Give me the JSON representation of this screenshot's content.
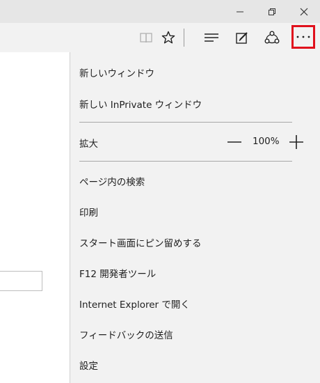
{
  "window_controls": {
    "minimize_icon": "minimize-icon",
    "restore_icon": "restore-icon",
    "close_icon": "close-icon"
  },
  "toolbar": {
    "icons": [
      "reading-view-icon",
      "favorite-star-icon",
      "hub-icon",
      "web-note-icon",
      "share-icon",
      "more-actions-icon"
    ],
    "highlight_color": "#e0101c"
  },
  "menu": {
    "new_window": "新しいウィンドウ",
    "new_inprivate": "新しい InPrivate ウィンドウ",
    "zoom_label": "拡大",
    "zoom_value": "100%",
    "find_on_page": "ページ内の検索",
    "print": "印刷",
    "pin_to_start": "スタート画面にピン留めする",
    "f12_tools": "F12 開発者ツール",
    "open_ie": "Internet Explorer で開く",
    "send_feedback": "フィードバックの送信",
    "settings": "設定"
  }
}
